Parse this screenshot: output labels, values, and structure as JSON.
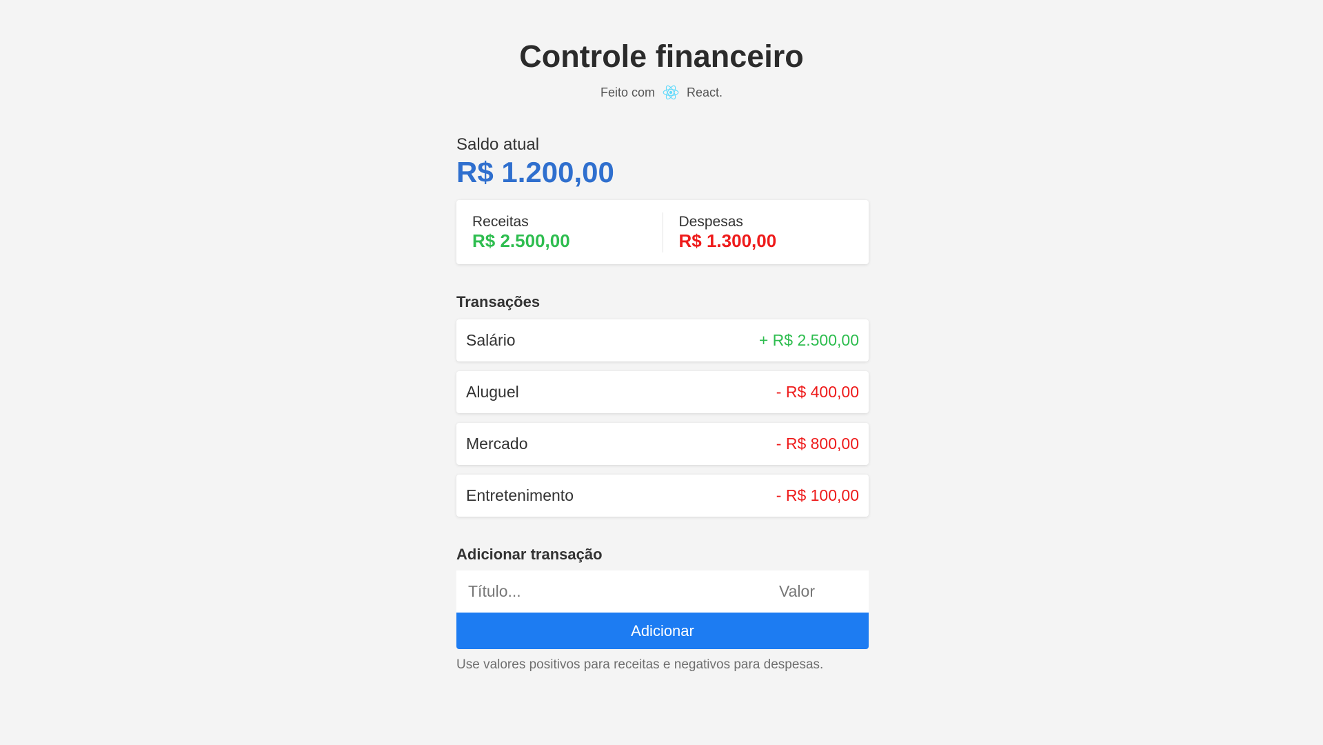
{
  "header": {
    "title": "Controle financeiro",
    "subtitle_prefix": "Feito com",
    "subtitle_icon": "react-logo-icon",
    "subtitle_suffix": "React."
  },
  "balance": {
    "label": "Saldo atual",
    "value": "R$ 1.200,00"
  },
  "summary": {
    "income_label": "Receitas",
    "income_value": "R$ 2.500,00",
    "expense_label": "Despesas",
    "expense_value": "R$ 1.300,00"
  },
  "transactions": {
    "title": "Transações",
    "items": [
      {
        "name": "Salário",
        "amount": "+ R$ 2.500,00",
        "type": "income"
      },
      {
        "name": "Aluguel",
        "amount": "- R$ 400,00",
        "type": "expense"
      },
      {
        "name": "Mercado",
        "amount": "- R$ 800,00",
        "type": "expense"
      },
      {
        "name": "Entretenimento",
        "amount": "- R$ 100,00",
        "type": "expense"
      }
    ]
  },
  "form": {
    "title": "Adicionar transação",
    "title_placeholder": "Título...",
    "value_placeholder": "Valor",
    "button_label": "Adicionar",
    "hint": "Use valores positivos para receitas e negativos para despesas."
  },
  "colors": {
    "balance": "#2f6fce",
    "income": "#2ebd4f",
    "expense": "#ee1b1b",
    "button": "#1d7cf2",
    "react": "#61dafb"
  }
}
